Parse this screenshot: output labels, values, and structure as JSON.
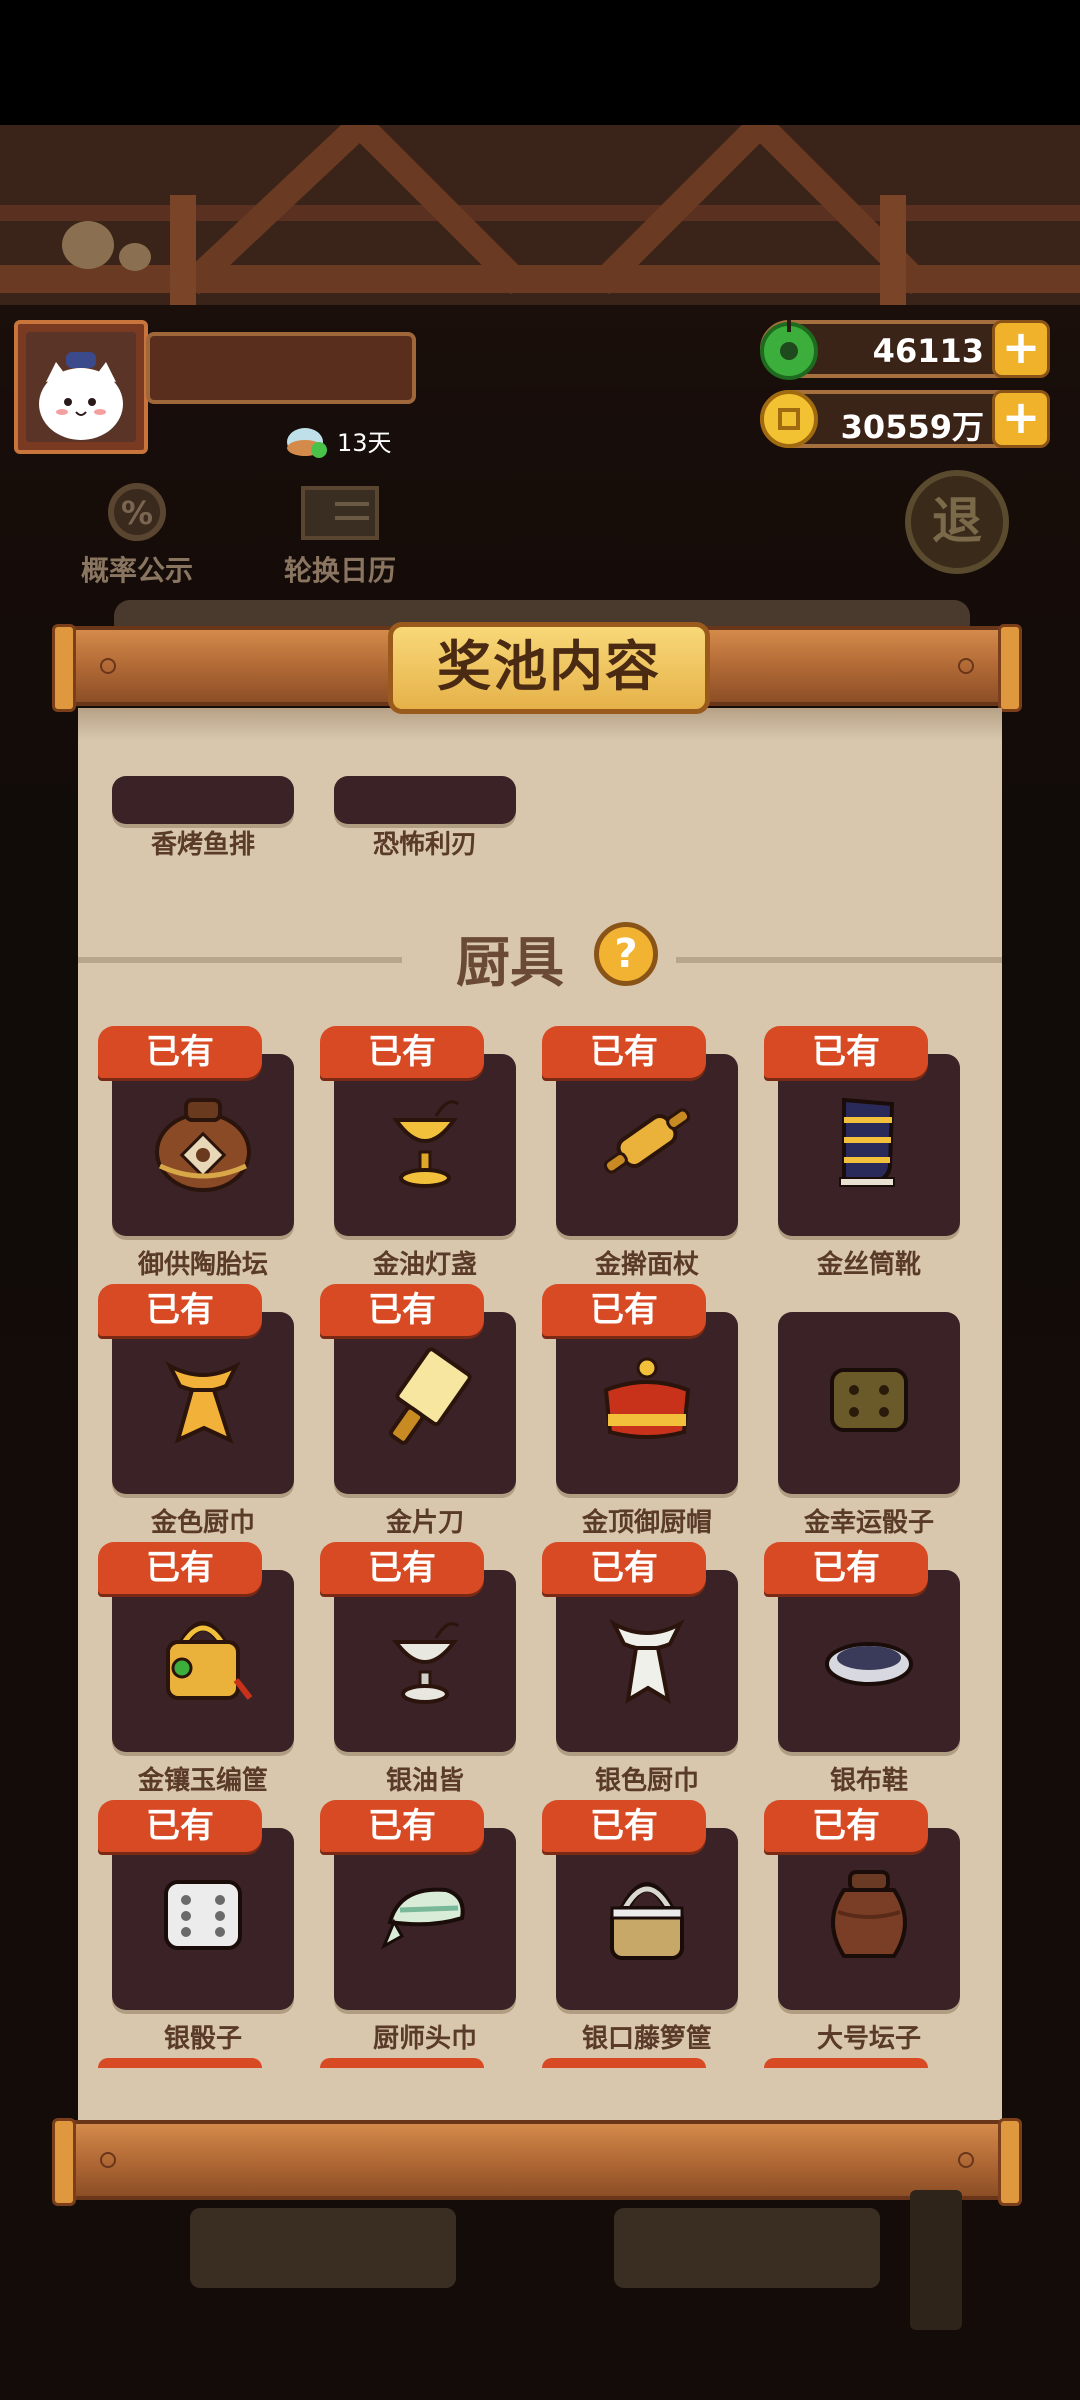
{
  "hud": {
    "days": "13天",
    "jade": "46113",
    "coins": "30559万",
    "plus": "+",
    "probability_label": "概率公示",
    "calendar_label": "轮换日历",
    "retreat_label": "退"
  },
  "panel": {
    "title": "奖池内容",
    "prev_items": [
      "香烤鱼排",
      "恐怖利刃"
    ],
    "section_title": "厨具",
    "help": "?",
    "owned_label": "已有",
    "items": [
      {
        "name": "御供陶胎坛",
        "owned": true,
        "icon": "clay-jar-icon"
      },
      {
        "name": "金油灯盏",
        "owned": true,
        "icon": "gold-oil-lamp-icon"
      },
      {
        "name": "金擀面杖",
        "owned": true,
        "icon": "gold-rolling-pin-icon"
      },
      {
        "name": "金丝筒靴",
        "owned": true,
        "icon": "boot-icon"
      },
      {
        "name": "金色厨巾",
        "owned": true,
        "icon": "gold-scarf-icon"
      },
      {
        "name": "金片刀",
        "owned": true,
        "icon": "gold-cleaver-icon"
      },
      {
        "name": "金顶御厨帽",
        "owned": true,
        "icon": "chef-hat-icon"
      },
      {
        "name": "金幸运骰子",
        "owned": false,
        "icon": "gold-dice-icon"
      },
      {
        "name": "金镶玉编筐",
        "owned": true,
        "icon": "gold-basket-icon"
      },
      {
        "name": "银油皆",
        "owned": true,
        "icon": "silver-oil-lamp-icon"
      },
      {
        "name": "银色厨巾",
        "owned": true,
        "icon": "silver-scarf-icon"
      },
      {
        "name": "银布鞋",
        "owned": true,
        "icon": "cloth-shoe-icon"
      },
      {
        "name": "银骰子",
        "owned": true,
        "icon": "silver-dice-icon"
      },
      {
        "name": "厨师头巾",
        "owned": true,
        "icon": "headscarf-icon"
      },
      {
        "name": "银口藤箩筐",
        "owned": true,
        "icon": "rattan-basket-icon"
      },
      {
        "name": "大号坛子",
        "owned": true,
        "icon": "big-jar-icon"
      }
    ]
  },
  "colors": {
    "owned_badge": "#d84a24",
    "card_bg": "#3a2226",
    "paper": "#d8c7ad",
    "title_plate": "#f0c45a"
  }
}
